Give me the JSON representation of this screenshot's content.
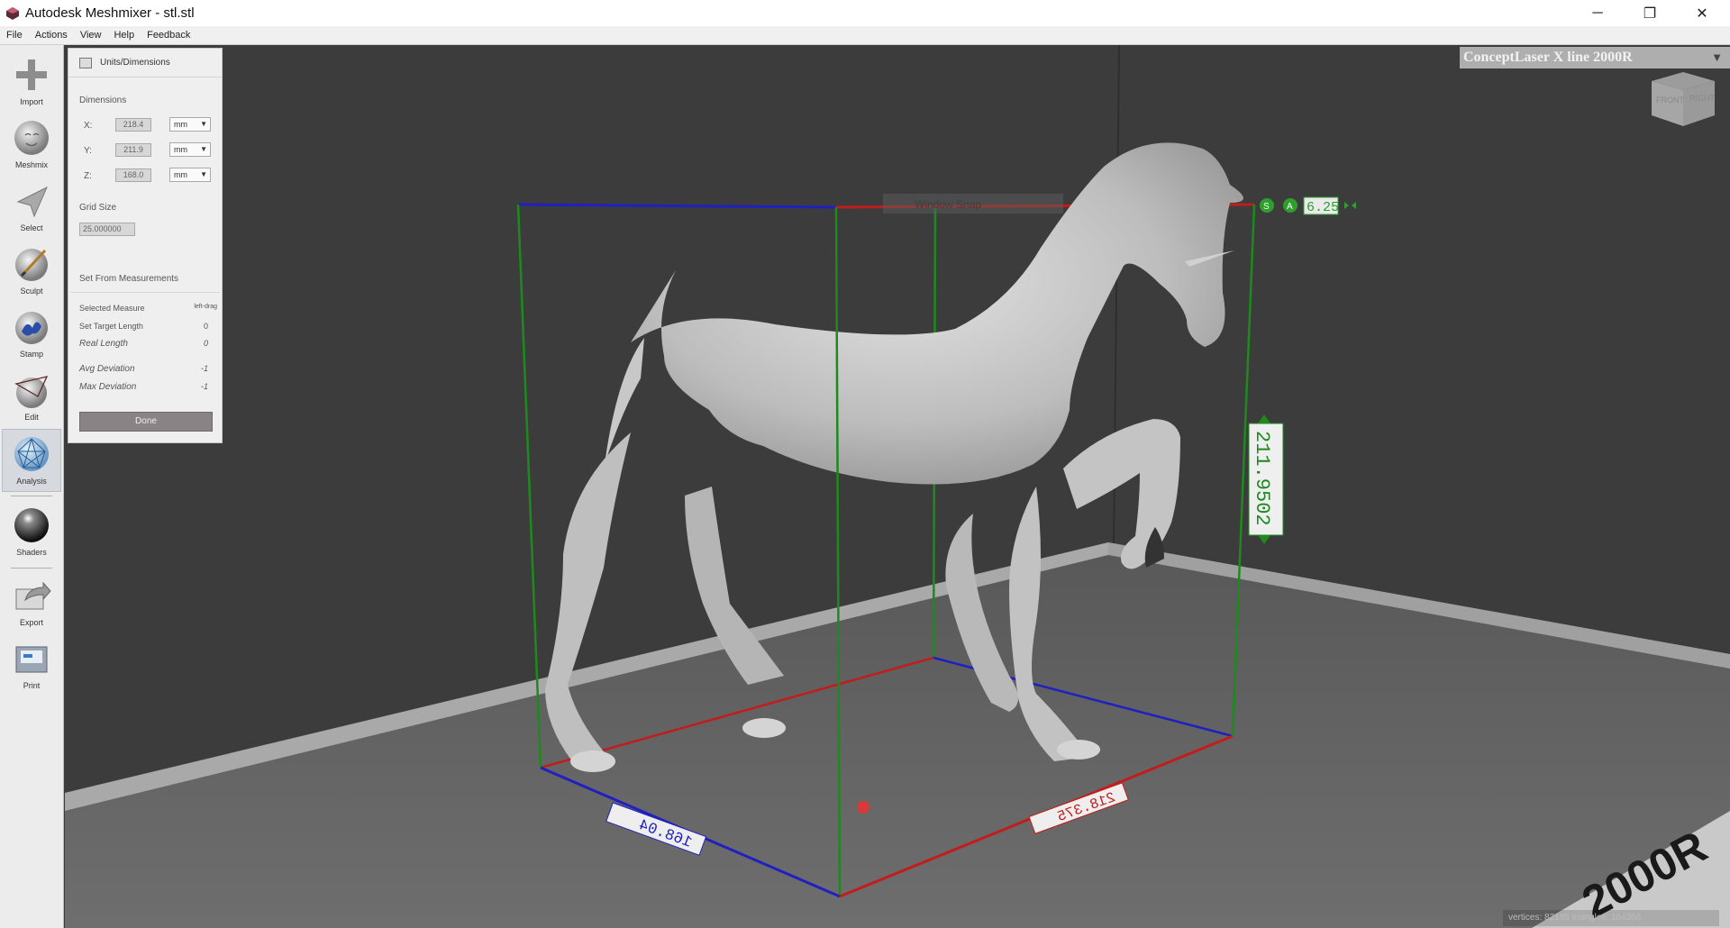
{
  "window": {
    "title": "Autodesk Meshmixer - stl.stl",
    "minimize_glyph": "─",
    "restore_glyph": "❐",
    "close_glyph": "✕"
  },
  "menu": [
    "File",
    "Actions",
    "View",
    "Help",
    "Feedback"
  ],
  "tools": [
    {
      "label": "Import",
      "icon": "import-icon"
    },
    {
      "label": "Meshmix",
      "icon": "meshmix-icon"
    },
    {
      "label": "Select",
      "icon": "select-icon"
    },
    {
      "label": "Sculpt",
      "icon": "sculpt-icon"
    },
    {
      "label": "Stamp",
      "icon": "stamp-icon"
    },
    {
      "label": "Edit",
      "icon": "edit-icon"
    },
    {
      "label": "Analysis",
      "icon": "analysis-icon",
      "active": true
    },
    {
      "label": "Shaders",
      "icon": "shaders-icon"
    },
    {
      "label": "Export",
      "icon": "export-icon"
    },
    {
      "label": "Print",
      "icon": "print-icon"
    }
  ],
  "panel": {
    "title": "Units/Dimensions",
    "dimensions_label": "Dimensions",
    "x_label": "X:",
    "x_value": "218.4",
    "x_unit": "mm",
    "y_label": "Y:",
    "y_value": "211.9",
    "y_unit": "mm",
    "z_label": "Z:",
    "z_value": "168.0",
    "z_unit": "mm",
    "grid_size_label": "Grid Size",
    "grid_size_value": "25.000000",
    "set_from_label": "Set From Measurements",
    "selected_measure_label": "Selected Measure",
    "selected_measure_value": "left-drag",
    "set_target_length_label": "Set Target Length",
    "set_target_length_value": "0",
    "real_length_label": "Real Length",
    "real_length_value": "0",
    "avg_deviation_label": "Avg Deviation",
    "avg_deviation_value": "-1",
    "max_deviation_label": "Max Deviation",
    "max_deviation_value": "-1",
    "done_label": "Done"
  },
  "viewport": {
    "printer_name": "ConceptLaser X line 2000R",
    "viewcube_front": "FRONT",
    "viewcube_right": "RIGHT",
    "axis_hint": "Window Snap",
    "tolerance_value": "6.25",
    "snap_label": "S",
    "align_label": "A",
    "dim_y_value": "211.9502",
    "dim_x_value": "218.375",
    "dim_z_value": "168.04",
    "bed_text": "2000R",
    "status": "vertices: 82185 triangles: 164366"
  },
  "colors": {
    "axis_x": "#c21c1c",
    "axis_y": "#2020c0",
    "axis_z": "#1e8a1e",
    "background": "#3b3b3b",
    "floor": "#6a6a6a"
  }
}
